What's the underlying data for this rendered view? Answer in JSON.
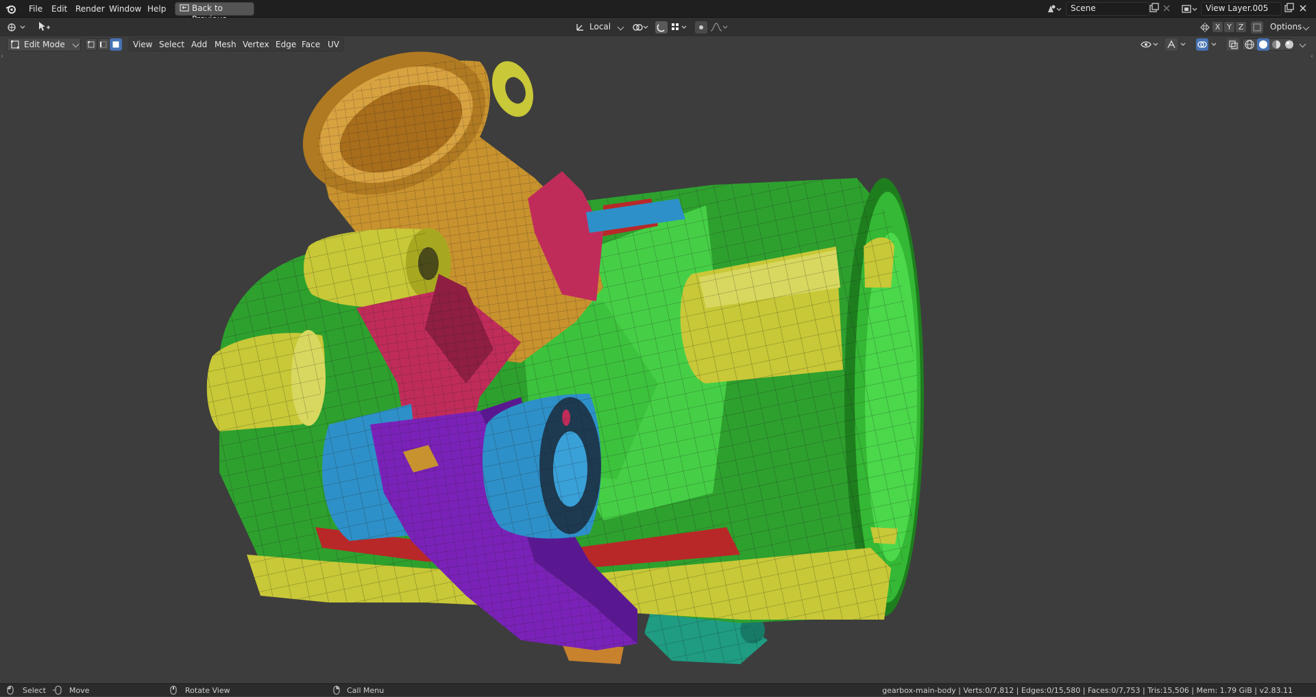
{
  "topbar": {
    "menus": [
      "File",
      "Edit",
      "Render",
      "Window",
      "Help"
    ],
    "back_button": "Back to Previous",
    "scene_name": "Scene",
    "view_layer": "View Layer.005"
  },
  "toolbar": {
    "orientation": "Local",
    "options_label": "Options",
    "axes": [
      "X",
      "Y",
      "Z"
    ]
  },
  "header": {
    "mode": "Edit Mode",
    "menus": [
      "View",
      "Select",
      "Add",
      "Mesh",
      "Vertex",
      "Edge",
      "Face",
      "UV"
    ]
  },
  "statusbar": {
    "select": "Select",
    "move": "Move",
    "rotate": "Rotate View",
    "call_menu": "Call Menu",
    "stats": "gearbox-main-body | Verts:0/7,812 | Edges:0/15,580 | Faces:0/7,753 | Tris:15,506 | Mem: 1.79 GiB | v2.83.11"
  },
  "colors": {
    "green": "#2ea02e",
    "light_green": "#4bd84b",
    "yellow": "#c8c838",
    "orange": "#c8922e",
    "magenta": "#c02c5a",
    "red": "#b82828",
    "purple": "#7a22b8",
    "blue": "#2e90c8",
    "teal": "#20a084",
    "accent": "#4772b3"
  }
}
